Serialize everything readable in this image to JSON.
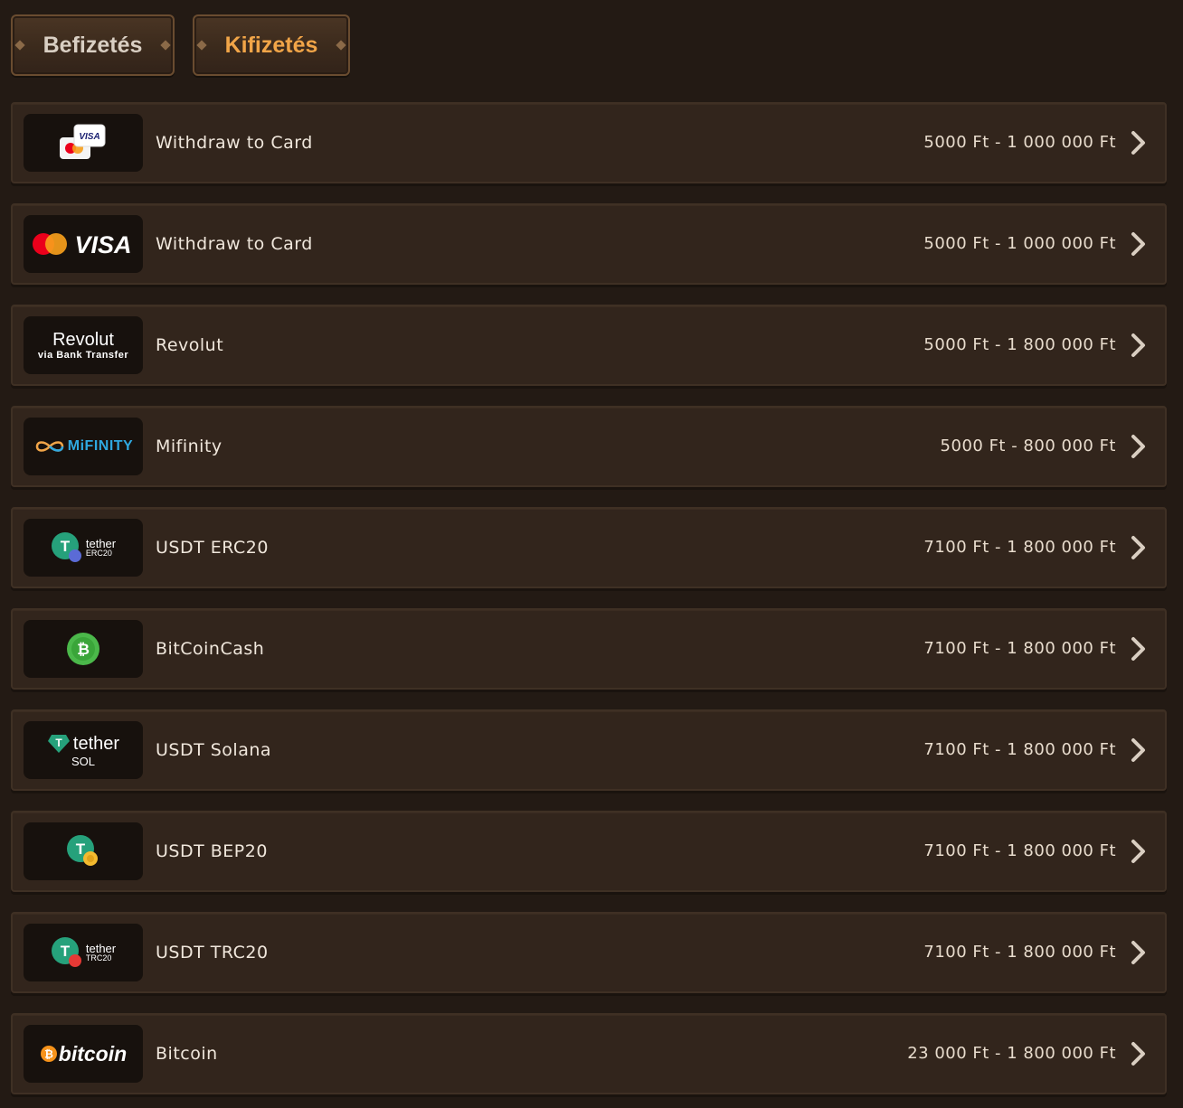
{
  "tabs": {
    "deposit_label": "Befizetés",
    "withdraw_label": "Kifizetés",
    "active": "withdraw"
  },
  "colors": {
    "background": "#231a14",
    "row": "#32251c",
    "active_tab_text": "#f1a548",
    "inactive_tab_text": "#d9cfc3",
    "tether_green": "#26a17b",
    "bch_green": "#4bb84a",
    "bitcoin_orange": "#f7931a",
    "mifinity_blue": "#2fa8e0"
  },
  "methods": [
    {
      "name": "Withdraw to Card",
      "range": "5000 Ft - 1 000 000 Ft",
      "logo": "card-stack-icon",
      "logo_text": "VISA"
    },
    {
      "name": "Withdraw to Card",
      "range": "5000 Ft - 1 000 000 Ft",
      "logo": "mastercard-visa-logo",
      "logo_text": "VISA"
    },
    {
      "name": "Revolut",
      "range": "5000 Ft - 1 800 000 Ft",
      "logo": "revolut-logo",
      "logo_text": "Revolut",
      "logo_sub": "via Bank Transfer"
    },
    {
      "name": "Mifinity",
      "range": "5000 Ft - 800 000 Ft",
      "logo": "mifinity-logo",
      "logo_text": "MiFINITY"
    },
    {
      "name": "USDT ERC20",
      "range": "7100 Ft - 1 800 000 Ft",
      "logo": "tether-erc20-logo",
      "logo_text": "tether",
      "logo_sub": "ERC20"
    },
    {
      "name": "BitCoinCash",
      "range": "7100 Ft - 1 800 000 Ft",
      "logo": "bitcoincash-icon"
    },
    {
      "name": "USDT Solana",
      "range": "7100 Ft - 1 800 000 Ft",
      "logo": "tether-sol-logo",
      "logo_text": "tether",
      "logo_sub": "SOL"
    },
    {
      "name": "USDT BEP20",
      "range": "7100 Ft - 1 800 000 Ft",
      "logo": "tether-bep20-icon"
    },
    {
      "name": "USDT TRC20",
      "range": "7100 Ft - 1 800 000 Ft",
      "logo": "tether-trc20-logo",
      "logo_text": "tether",
      "logo_sub": "TRC20"
    },
    {
      "name": "Bitcoin",
      "range": "23 000 Ft - 1 800 000 Ft",
      "logo": "bitcoin-logo",
      "logo_text": "bitcoin"
    }
  ]
}
